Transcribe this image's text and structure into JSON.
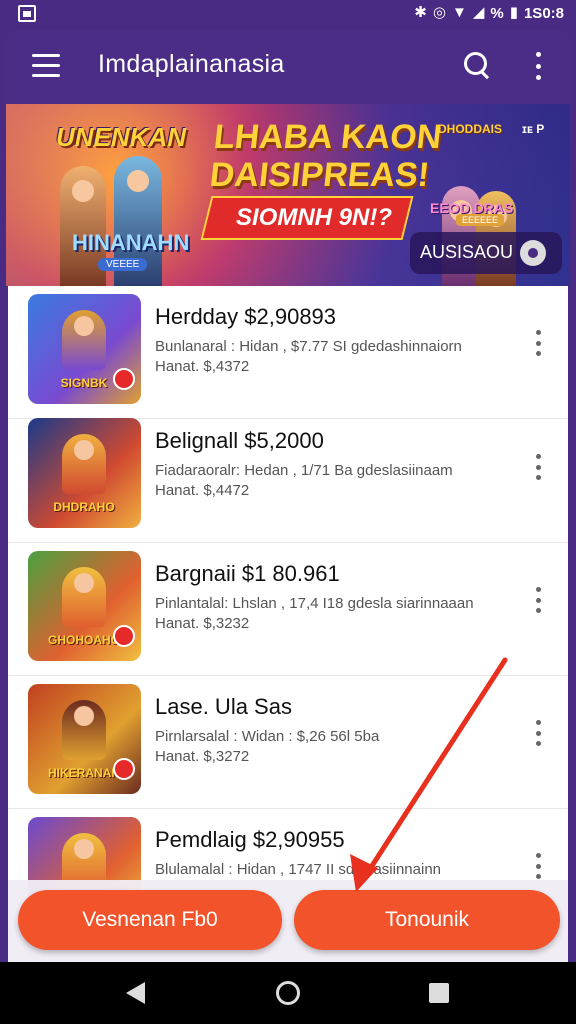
{
  "status_bar": {
    "left_icon": "notification-image-icon",
    "icons": [
      "bluetooth-icon",
      "alarm-icon",
      "wifi-icon",
      "signal-icon",
      "battery-icon"
    ],
    "battery_pct": "%",
    "time": "1S0:8"
  },
  "app_bar": {
    "title": "Imdaplainanasia",
    "icons": [
      "menu-icon",
      "search-icon",
      "more-vert-icon"
    ]
  },
  "banner": {
    "logo_left": "UNENKAN",
    "sub_left": "HINANAHN",
    "sub_left_tag": "VEEEE",
    "headline_line1": "LHABA KAON",
    "headline_line2": "DAISIPREAS!",
    "ribbon": "SIOMNH 9N!?",
    "right_logo": "DHODDAIS",
    "right_icon_text": "ɪᴇ P",
    "right_game": "EEOD DRAS",
    "right_tag": "EEEEEE",
    "pill_label": "AUSISAOU",
    "pill_icon": "disc-icon"
  },
  "games": [
    {
      "title": "Herdday $2,90893",
      "line1": "Bunlanaral : Hidan , $7.77 SI gdedashinnaiorn",
      "line2": "Hanat. $,4372",
      "thumb_logo": "SIGNBK",
      "colors": [
        "#3a7be0",
        "#7a4ad0",
        "#e0a030"
      ]
    },
    {
      "title": "Belignall $5,2000",
      "line1": "Fiadaraoralr: Hedan , 1/71 Ba gdeslasiinaam",
      "line2": "Hanat. $,4472",
      "thumb_logo": "DHDRAHO",
      "colors": [
        "#1a3a8a",
        "#d04a30",
        "#f0b040"
      ]
    },
    {
      "title": "Bargnaii $1 80.961",
      "line1": "Pinlantalal: Lhslan , 17,4 I18 gdesla siarinnaaan",
      "line2": "Hanat. $,3232",
      "thumb_logo": "GHOHOAHG",
      "colors": [
        "#4aa040",
        "#e06030",
        "#f0c040"
      ]
    },
    {
      "title": "Lase. Ula Sas",
      "line1": "Pirnlarsalal : Widan : $,26 56l 5ba",
      "line2": "Hanat. $,3272",
      "thumb_logo": "HIKERANAN",
      "colors": [
        "#c04020",
        "#e0a030",
        "#6a2a20"
      ]
    },
    {
      "title": "Pemdlaig $2,90955",
      "line1": "Blulamalal : Hidan , 1747 II sdeslasiinnainn",
      "line2": "",
      "thumb_logo": "",
      "colors": [
        "#6a4ad0",
        "#e06030",
        "#f0c040"
      ]
    }
  ],
  "actions": {
    "left_button": "Vesnenan Fb0",
    "right_button": "Tonounik"
  },
  "annotation": {
    "color": "#e8301f",
    "target": "right_button"
  },
  "nav_bar": {
    "icons": [
      "back-icon",
      "home-icon",
      "recents-icon"
    ]
  }
}
